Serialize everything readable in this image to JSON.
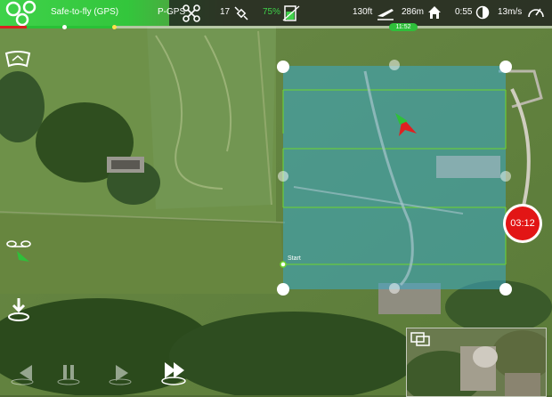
{
  "status": {
    "safe_to_fly": "Safe-to-fly (GPS)",
    "flight_mode": "P-GPS",
    "satellites": "17",
    "battery": "75%",
    "altitude": "130ft",
    "distance": "286m",
    "flight_time": "0:55",
    "speed": "13m/s",
    "time_marker": "11:52"
  },
  "recording": {
    "timer": "03:12"
  },
  "map": {
    "start_label": "Start"
  },
  "colors": {
    "accent": "#33c63c",
    "record": "#e21515",
    "grid": "#6fd62c",
    "area": "#3aa9c8"
  }
}
